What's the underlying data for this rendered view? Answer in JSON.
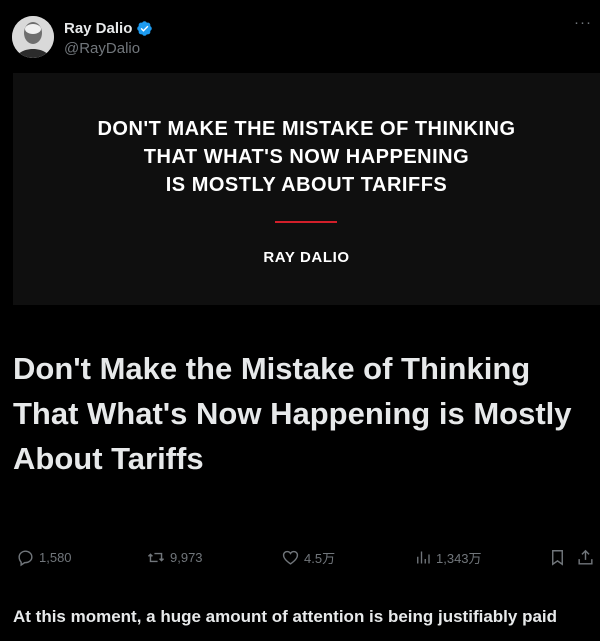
{
  "author": {
    "name": "Ray Dalio",
    "handle": "@RayDalio",
    "verified_color": "#1d9bf0"
  },
  "more_label": "···",
  "banner": {
    "headline_lines": [
      "DON'T MAKE THE MISTAKE OF THINKING",
      "THAT WHAT'S NOW HAPPENING",
      "IS MOSTLY ABOUT TARIFFS"
    ],
    "author": "RAY DALIO",
    "accent_color": "#d21f2a"
  },
  "article": {
    "title": "Don't Make the Mistake of Thinking That What's Now Happening is Mostly About Tariffs",
    "body_preview": "At this moment, a huge amount of attention is being justifiably paid"
  },
  "actions": {
    "replies": "1,580",
    "reposts": "9,973",
    "likes": "4.5万",
    "views": "1,343万"
  },
  "icons": {
    "reply": "reply-icon",
    "repost": "repost-icon",
    "like": "heart-icon",
    "views": "views-icon",
    "bookmark": "bookmark-icon",
    "share": "share-icon",
    "verified": "verified-badge-icon"
  }
}
